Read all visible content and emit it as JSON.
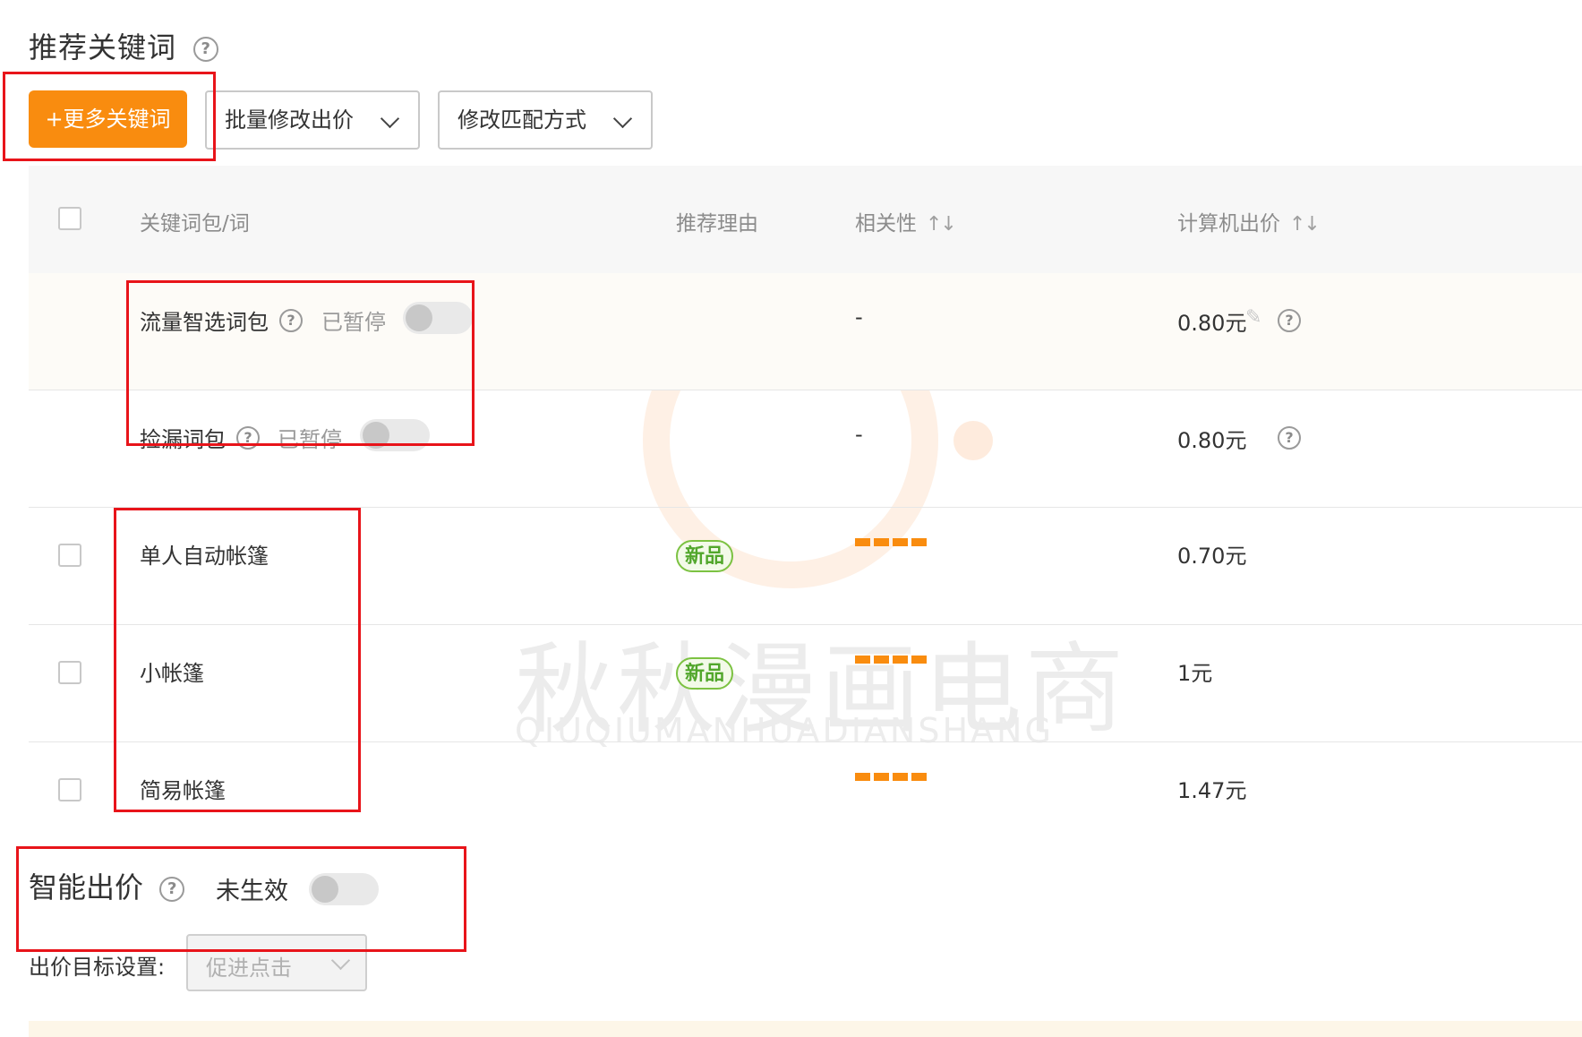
{
  "section": {
    "title": "推荐关键词"
  },
  "toolbar": {
    "more_keywords": "+更多关键词",
    "batch_bid": "批量修改出价",
    "match_mode": "修改匹配方式"
  },
  "table": {
    "headers": {
      "keyword": "关键词包/词",
      "reason": "推荐理由",
      "relevance": "相关性",
      "pc_bid": "计算机出价",
      "sort_glyph": "↑↓"
    },
    "rows": [
      {
        "name": "流量智选词包",
        "status": "已暂停",
        "relevance": "-",
        "bid": "0.80元"
      },
      {
        "name": "捡漏词包",
        "status": "已暂停",
        "relevance": "-",
        "bid": "0.80元"
      },
      {
        "name": "单人自动帐篷",
        "reason": "新品",
        "relevance_level": 4,
        "bid": "0.70元"
      },
      {
        "name": "小帐篷",
        "reason": "新品",
        "relevance_level": 4,
        "bid": "1元"
      },
      {
        "name": "简易帐篷",
        "relevance_level": 4,
        "bid": "1.47元"
      }
    ]
  },
  "smart_bid": {
    "title": "智能出价",
    "status": "未生效",
    "goal_label": "出价目标设置:",
    "goal_value": "促进点击"
  },
  "watermark": {
    "text": "秋秋漫画电商",
    "sub": "QIUQIUMANHUADIANSHANG"
  },
  "icons": {
    "help": "?",
    "pencil": "✎"
  },
  "colors": {
    "accent": "#f98c0f",
    "highlight": "#e8141a",
    "new_badge": "#52a72c"
  }
}
